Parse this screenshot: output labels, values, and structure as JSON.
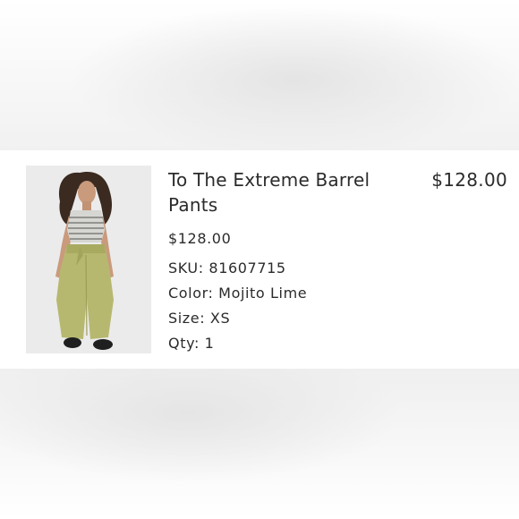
{
  "product": {
    "title": "To The Extreme Barrel Pants",
    "unit_price": "$128.00",
    "line_total": "$128.00",
    "image_icon": "product-photo-model-wearing-green-barrel-pants",
    "attributes": [
      {
        "label": "SKU:",
        "value": "81607715"
      },
      {
        "label": "Color:",
        "value": "Mojito Lime"
      },
      {
        "label": "Size:",
        "value": "XS"
      },
      {
        "label": "Qty:",
        "value": "1"
      }
    ]
  },
  "colors": {
    "text": "#2b2b2b",
    "pants": "#b7b86f",
    "background": "#ebebeb"
  }
}
